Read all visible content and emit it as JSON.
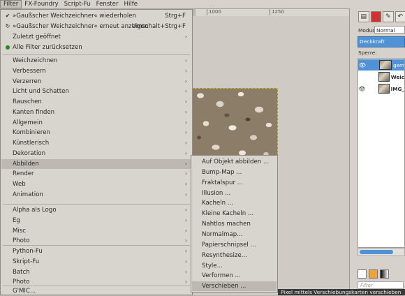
{
  "menubar": [
    "Filter",
    "FX-Foundry",
    "Script-Fu",
    "Fenster",
    "Hilfe"
  ],
  "ruler": [
    "1000",
    "1250"
  ],
  "menu": {
    "repeat": {
      "label": "»Gaußscher Weichzeichner« wiederholen",
      "shortcut": "Strg+F"
    },
    "reshow": {
      "label": "»Gaußscher Weichzeichner« erneut anzeigen",
      "shortcut": "Umschalt+Strg+F"
    },
    "recent": "Zuletzt geöffnet",
    "reset": "Alle Filter zurücksetzen",
    "items": [
      "Weichzeichnen",
      "Verbessern",
      "Verzerren",
      "Licht und Schatten",
      "Rauschen",
      "Kanten finden",
      "Allgemein",
      "Kombinieren",
      "Künstlerisch",
      "Dekoration",
      "Abbilden",
      "Render",
      "Web",
      "Animation"
    ],
    "items2": [
      "Alpha als Logo",
      "Eg",
      "Misc",
      "Photo"
    ],
    "items3": [
      "Python-Fu",
      "Skript-Fu",
      "Batch",
      "Photo"
    ],
    "gmic": "G'MIC..."
  },
  "submenu": [
    "Auf Objekt abbilden ...",
    "Bump-Map ...",
    "Fraktalspur ...",
    "Illusion ...",
    "Kacheln ...",
    "Kleine Kacheln ...",
    "Nahtlos machen",
    "Normalmap...",
    "Papierschnipsel ...",
    "Resynthesize...",
    "Style...",
    "Verformen ...",
    "Verschieben ..."
  ],
  "tooltip": "Pixel mittels Verschiebungskarten verschieben",
  "dock": {
    "mode_label": "Modus:",
    "mode_value": "Normal",
    "opacity_label": "Deckkraft",
    "lock_label": "Sperre:",
    "layers": [
      "gem",
      "Weic",
      "IMG_"
    ],
    "filter_placeholder": "Filter"
  },
  "colors": {
    "accent": "#4f92d8",
    "menu_bg": "#d8d4ce",
    "highlight": "#bdb9b2"
  }
}
